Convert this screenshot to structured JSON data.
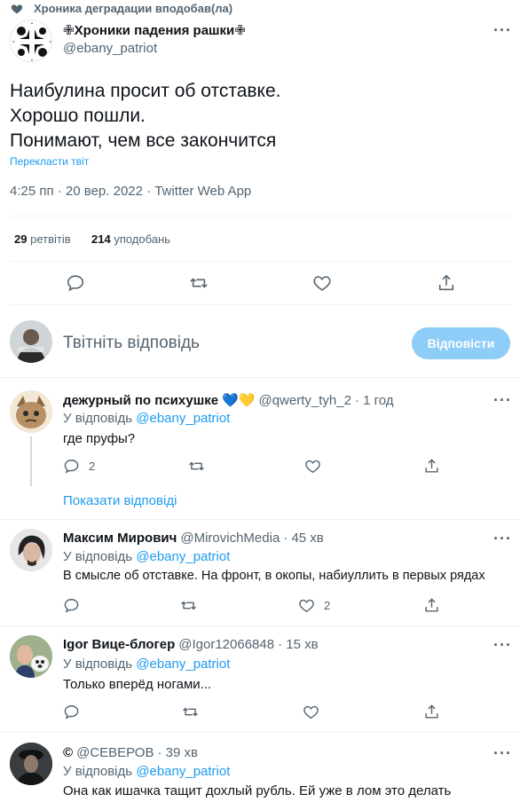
{
  "social_context": {
    "text": "Хроника деградации вподобав(ла)"
  },
  "main_tweet": {
    "display_name": "✙Хроники падения рашки✙",
    "handle": "@ebany_patriot",
    "text_lines": [
      "Наибулина просит об отставке.",
      "Хорошо пошли.",
      "Понимают, чем все закончится"
    ],
    "translate_label": "Перекласти твіт",
    "timestamp": "4:25 пп · 20 вер. 2022 · Twitter Web App",
    "retweets_count": "29",
    "retweets_label": "ретвітів",
    "likes_count": "214",
    "likes_label": "уподобань"
  },
  "compose": {
    "placeholder": "Твітніть відповідь",
    "reply_button": "Відповісти"
  },
  "replies": [
    {
      "display_name": "дежурный по психушке",
      "emoji": "💙💛",
      "handle": "@qwerty_tyh_2",
      "time": "· 1 год",
      "reply_prefix": "У відповідь",
      "reply_handle": "@ebany_patriot",
      "text": "где пруфы?",
      "reply_count": "2",
      "retweet_count": "",
      "like_count": "",
      "show_replies": "Показати відповіді"
    },
    {
      "display_name": "Максим Мирович",
      "handle": "@MirovichMedia",
      "time": "· 45 хв",
      "reply_prefix": "У відповідь",
      "reply_handle": "@ebany_patriot",
      "text": "В смысле об отставке. На фронт, в окопы, набиуллить в первых рядах",
      "reply_count": "",
      "retweet_count": "",
      "like_count": "2"
    },
    {
      "display_name": "Igor Вице-блогер",
      "handle": "@Igor12066848",
      "time": "· 15 хв",
      "reply_prefix": "У відповідь",
      "reply_handle": "@ebany_patriot",
      "text": "Только вперёд ногами...",
      "reply_count": "",
      "retweet_count": "",
      "like_count": ""
    },
    {
      "display_name": "©",
      "handle": "@СЕВЕРОВ",
      "time": "· 39 хв",
      "reply_prefix": "У відповідь",
      "reply_handle": "@ebany_patriot",
      "text": "Она как ишачка тащит дохлый рубль. Ей уже в лом это делать"
    }
  ],
  "more_glyph": "···",
  "colors": {
    "accent": "#1d9bf0",
    "muted": "#536471",
    "divider": "#eff3f4",
    "button_disabled": "#8ecdf8"
  },
  "icons": [
    "heart-icon",
    "more-icon",
    "reply-icon",
    "retweet-icon",
    "like-icon",
    "share-icon"
  ]
}
